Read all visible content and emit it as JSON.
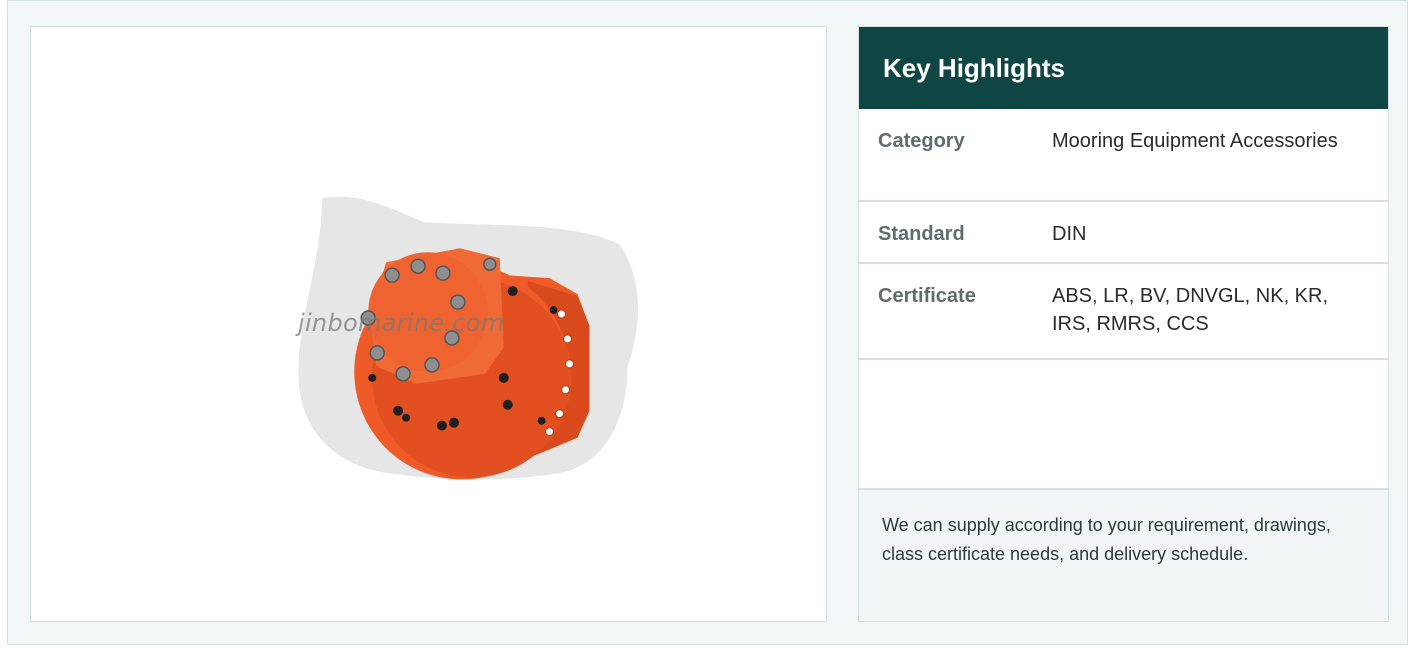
{
  "product_image": {
    "watermark": "jinbomarine.com",
    "body_color": "#ee5a28",
    "shadow_color": "#e6e6e6"
  },
  "highlights": {
    "title": "Key Highlights",
    "header_color": "#0f4542",
    "rows": [
      {
        "label": "Category",
        "value": "Mooring Equipment Accessories"
      },
      {
        "label": "Standard",
        "value": "DIN"
      },
      {
        "label": "Certificate",
        "value": "ABS, LR, BV, DNVGL, NK, KR, IRS, RMRS, CCS"
      }
    ],
    "note": "We can supply according to your requirement, drawings, class certificate needs, and delivery schedule."
  }
}
